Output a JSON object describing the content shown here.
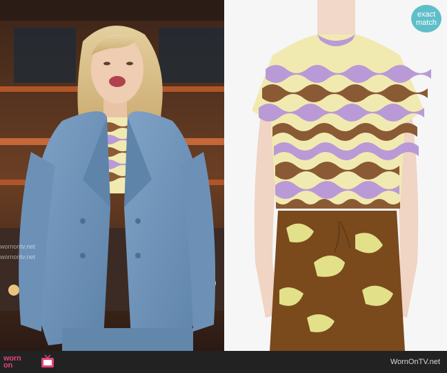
{
  "badge": {
    "line1": "exact",
    "line2": "match"
  },
  "footer": {
    "logo_line1": "worn",
    "logo_line2": "on",
    "site": "WornOnTV.net"
  },
  "watermark": {
    "text": "wornontv.net"
  },
  "colors": {
    "blazer": "#6f93b8",
    "stripe_brown": "#8a5a35",
    "stripe_lilac": "#b99ad6",
    "stripe_yellow": "#f1eab0",
    "skirt_brown": "#7a4a1c",
    "skirt_print": "#e3e08a"
  }
}
